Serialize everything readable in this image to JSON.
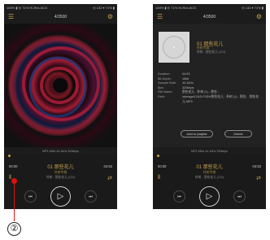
{
  "status_left": "100% ▮ ◎ 71% Hi-Res ACG",
  "status_right": "◎ 132 ▾ 71% ▮",
  "track_number": "4/3500",
  "menu_icon": "menu-icon",
  "settings_icon": "gear-icon",
  "quality_line": "MP3  16bit  44.1kHz  320kbps",
  "time_elapsed": "00:00",
  "time_total": "04:53",
  "song": {
    "title": "01 那些花儿",
    "album": "朴树专辑",
    "artist": "朴树 - 那些花儿 (CD)"
  },
  "controls": {
    "prev": "⏮",
    "play": "▷",
    "next": "⏭"
  },
  "info": {
    "title": "01 那些花儿",
    "sub1": "朴树专辑",
    "sub2": "朴树 - 那些花儿 (CD)",
    "rows": [
      {
        "key": "Duration:",
        "val": "04:53"
      },
      {
        "key": "Bit Depth:",
        "val": "16bit"
      },
      {
        "key": "Sample Rate:",
        "val": "44.1kHz"
      },
      {
        "key": "Bps:",
        "val": "320kbps"
      },
      {
        "key": "File Name:",
        "val": "那些花儿 - 朴树 (1) - 那些..."
      },
      {
        "key": "Path:",
        "val": "/storage/12AS-F0D9/那些花儿 - 朴树 (1) - 那些... 那些花儿.MP3"
      }
    ],
    "add_playlist": "Add to playlist",
    "delete": "Delete"
  },
  "callout_number": "②"
}
